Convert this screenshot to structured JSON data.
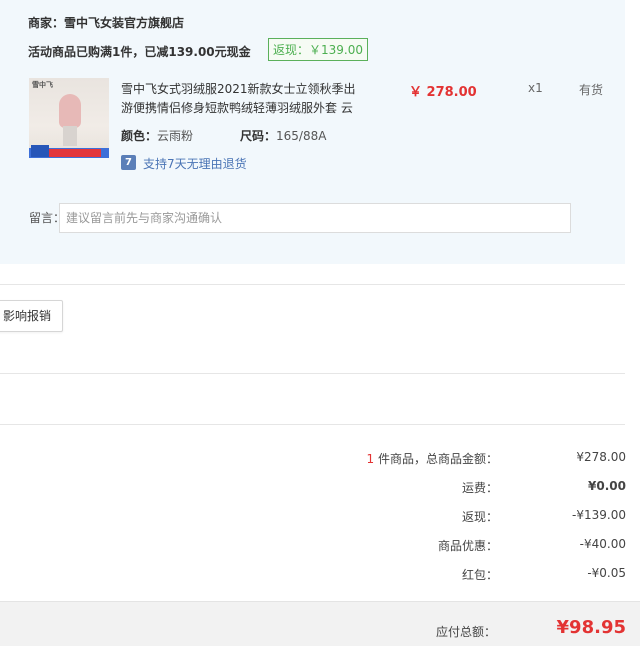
{
  "store": {
    "merchant_label": "商家：",
    "merchant_name": "雪中飞女装官方旗舰店",
    "promo_text": "活动商品已购满1件，已减139.00元现金",
    "cashback_tag": "返现：￥139.00"
  },
  "product": {
    "thumbnail_brand": "雪中飞",
    "title": "雪中飞女式羽绒服2021新款女士立领秋季出游便携情侣修身短款鸭绒轻薄羽绒服外套 云",
    "price": "￥ 278.00",
    "quantity": "x1",
    "stock_status": "有货",
    "color_label": "颜色：",
    "color_value": "云雨粉",
    "size_label": "尺码：",
    "size_value": "165/88A",
    "return_icon_glyph": "7",
    "return_policy": "支持7天无理由退货"
  },
  "message": {
    "label": "留言：",
    "placeholder": "建议留言前先与商家沟通确认",
    "value": ""
  },
  "invoice": {
    "button_label": "影响报销"
  },
  "summary": {
    "item_count": "1",
    "items_label": " 件商品，总商品金额：",
    "items_total": "¥278.00",
    "shipping_label": "运费：",
    "shipping_value": "¥0.00",
    "cashback_label": "返现：",
    "cashback_value": "-¥139.00",
    "discount_label": "商品优惠：",
    "discount_value": "-¥40.00",
    "redpacket_label": "红包：",
    "redpacket_value": "-¥0.05",
    "payable_label": "应付总额：",
    "payable_value": "¥98.95"
  },
  "colors": {
    "accent_red": "#e33333",
    "cashback_green": "#4caf50",
    "link_blue": "#4a74b5",
    "panel_bg": "#f2f8fc"
  }
}
